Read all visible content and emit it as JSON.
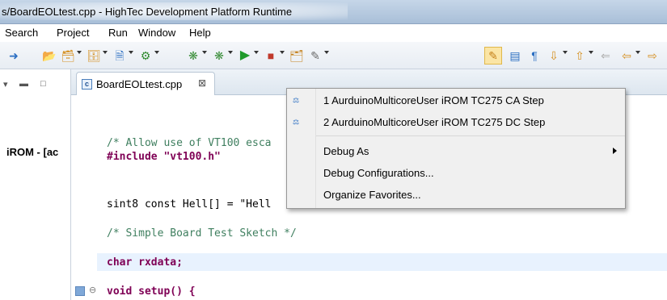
{
  "window": {
    "title": "s/BoardEOLtest.cpp - HighTec Development Platform Runtime"
  },
  "menubar": {
    "items": [
      "Search",
      "Project",
      "Run",
      "Window",
      "Help"
    ]
  },
  "outline": {
    "label": "iROM - [ac"
  },
  "editor_tab": {
    "label": "BoardEOLtest.cpp",
    "icon": "c-file-icon",
    "close_glyph": "⊠"
  },
  "code": {
    "lines": [
      "/* Allow use of VT100 esca",
      "#include \"vt100.h\"",
      "sint8 const Hell[] = \"Hell",
      "/* Simple Board Test Sketch */",
      "char rxdata;",
      "void setup() {"
    ]
  },
  "popup_menu": {
    "favorites": [
      {
        "label": "1 AurduinoMulticoreUser iROM TC275 CA Step",
        "icon": "debug-config-icon"
      },
      {
        "label": "2 AurduinoMulticoreUser iROM TC275 DC Step",
        "icon": "debug-config-icon"
      }
    ],
    "debug_as": "Debug As",
    "debug_configurations": "Debug Configurations...",
    "organize_favorites": "Organize Favorites..."
  },
  "colors": {
    "comment": "#3f7f5f",
    "keyword": "#7f0055",
    "string": "#2a00ff",
    "current_line": "#e8f2fe",
    "active_tool": "#fbe5a5"
  }
}
